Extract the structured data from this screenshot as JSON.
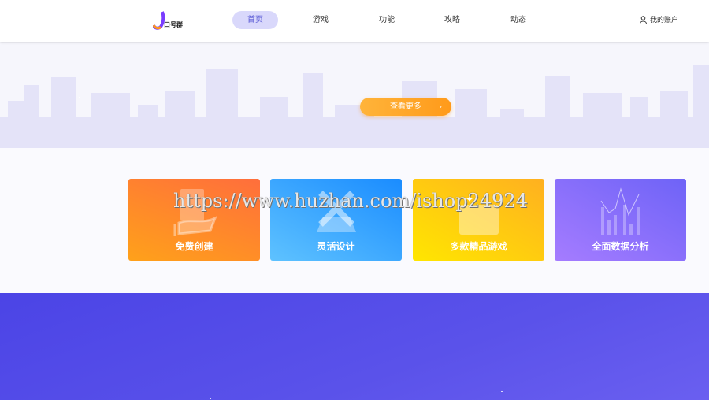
{
  "header": {
    "logo_text": "口号群",
    "nav": [
      "首页",
      "游戏",
      "功能",
      "攻略",
      "动态"
    ],
    "account": "我的账户"
  },
  "hero": {
    "button": "查看更多",
    "button_arrow": "›"
  },
  "features": [
    {
      "label": "免费创建",
      "icon": "hand-money-icon",
      "colors": [
        "#ff9d1e",
        "#ff6e3c"
      ]
    },
    {
      "label": "灵活设计",
      "icon": "pencil-ruler-icon",
      "colors": [
        "#5ec2ff",
        "#1a8cff"
      ]
    },
    {
      "label": "多款精品游戏",
      "icon": "game-box-icon",
      "colors": [
        "#ffe600",
        "#ffb020"
      ]
    },
    {
      "label": "全面数据分析",
      "icon": "chart-icon",
      "colors": [
        "#a07cff",
        "#6e63f7"
      ]
    }
  ],
  "watermark": "https://www.huzhan.com/ishop24924"
}
